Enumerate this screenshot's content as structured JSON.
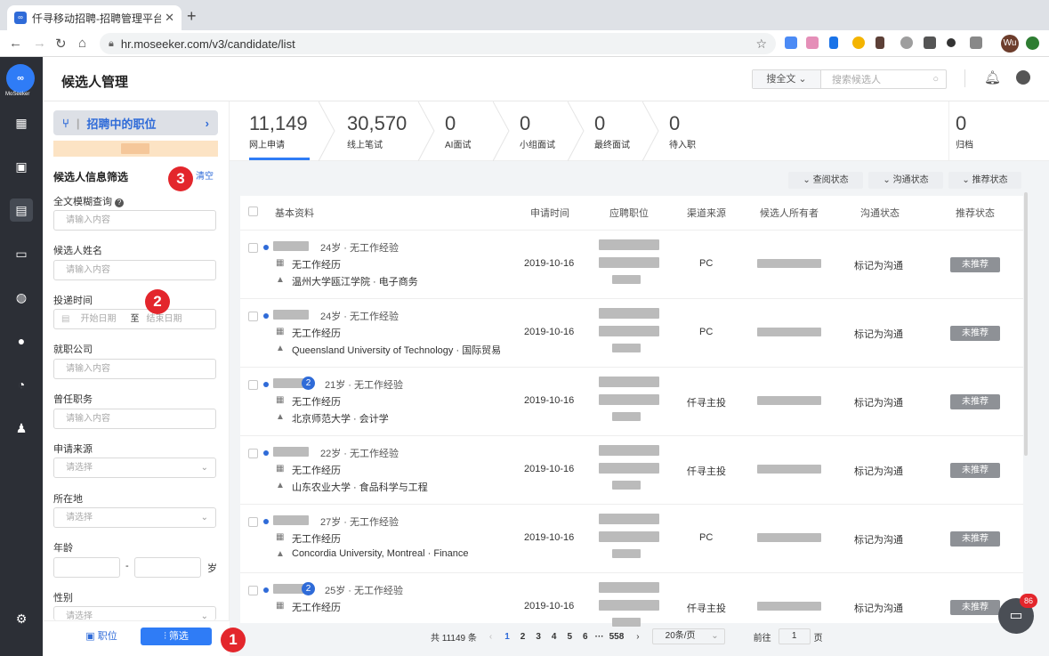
{
  "browser": {
    "tab_title": "仟寻移动招聘-招聘管理平台",
    "url": "hr.moseeker.com/v3/candidate/list",
    "user_initials": "Wu"
  },
  "header": {
    "title": "候选人管理",
    "search_scope": "搜全文",
    "search_placeholder": "搜索候选人"
  },
  "logo": {
    "text": "∞",
    "caption": "MoSeeker"
  },
  "filter": {
    "job_button": "招聘中的职位",
    "title": "候选人信息筛选",
    "clear": "清空",
    "fulltext_label": "全文模糊查询",
    "fulltext_placeholder": "请输入内容",
    "name_label": "候选人姓名",
    "name_placeholder": "请输入内容",
    "time_label": "投递时间",
    "start_date": "开始日期",
    "to": "至",
    "end_date": "结束日期",
    "company_label": "就职公司",
    "company_placeholder": "请输入内容",
    "position_label": "曾任职务",
    "position_placeholder": "请输入内容",
    "source_label": "申请来源",
    "source_placeholder": "请选择",
    "location_label": "所在地",
    "location_placeholder": "请选择",
    "age_label": "年龄",
    "age_dash": "-",
    "age_unit": "岁",
    "gender_label": "性别",
    "gender_placeholder": "请选择",
    "btn_job": "职位",
    "btn_filter": "筛选"
  },
  "annotations": [
    "1",
    "2",
    "3"
  ],
  "stages": [
    {
      "count": "11,149",
      "label": "网上申请"
    },
    {
      "count": "30,570",
      "label": "线上笔试"
    },
    {
      "count": "0",
      "label": "AI面试"
    },
    {
      "count": "0",
      "label": "小组面试"
    },
    {
      "count": "0",
      "label": "最终面试"
    },
    {
      "count": "0",
      "label": "待入职"
    },
    {
      "count": "0",
      "label": "归档"
    }
  ],
  "status_filters": [
    "查阅状态",
    "沟通状态",
    "推荐状态"
  ],
  "table": {
    "headers": [
      "基本资料",
      "申请时间",
      "应聘职位",
      "渠道来源",
      "候选人所有者",
      "沟通状态",
      "推荐状态"
    ],
    "rows": [
      {
        "age": "24岁",
        "exp": "无工作经验",
        "work": "无工作经历",
        "school": "温州大学瓯江学院",
        "major": "电子商务",
        "date": "2019-10-16",
        "source": "PC",
        "comm": "标记为沟通",
        "rec": "未推荐",
        "badge": ""
      },
      {
        "age": "24岁",
        "exp": "无工作经验",
        "work": "无工作经历",
        "school": "Queensland University of Technology",
        "major": "国际贸易",
        "date": "2019-10-16",
        "source": "PC",
        "comm": "标记为沟通",
        "rec": "未推荐",
        "badge": ""
      },
      {
        "age": "21岁",
        "exp": "无工作经验",
        "work": "无工作经历",
        "school": "北京师范大学",
        "major": "会计学",
        "date": "2019-10-16",
        "source": "仟寻主投",
        "comm": "标记为沟通",
        "rec": "未推荐",
        "badge": "2"
      },
      {
        "age": "22岁",
        "exp": "无工作经验",
        "work": "无工作经历",
        "school": "山东农业大学",
        "major": "食品科学与工程",
        "date": "2019-10-16",
        "source": "仟寻主投",
        "comm": "标记为沟通",
        "rec": "未推荐",
        "badge": ""
      },
      {
        "age": "27岁",
        "exp": "无工作经验",
        "work": "无工作经历",
        "school": "Concordia University, Montreal",
        "major": "Finance",
        "date": "2019-10-16",
        "source": "PC",
        "comm": "标记为沟通",
        "rec": "未推荐",
        "badge": ""
      },
      {
        "age": "25岁",
        "exp": "无工作经验",
        "work": "无工作经历",
        "school": "",
        "major": "",
        "date": "2019-10-16",
        "source": "仟寻主投",
        "comm": "标记为沟通",
        "rec": "未推荐",
        "badge": "2"
      }
    ]
  },
  "pagination": {
    "total": "共 11149 条",
    "pages": [
      "1",
      "2",
      "3",
      "4",
      "5",
      "6"
    ],
    "ellipsis": "···",
    "last": "558",
    "per_page": "20条/页",
    "goto_label": "前往",
    "goto_value": "1",
    "goto_unit": "页"
  },
  "chat_badge": "86"
}
